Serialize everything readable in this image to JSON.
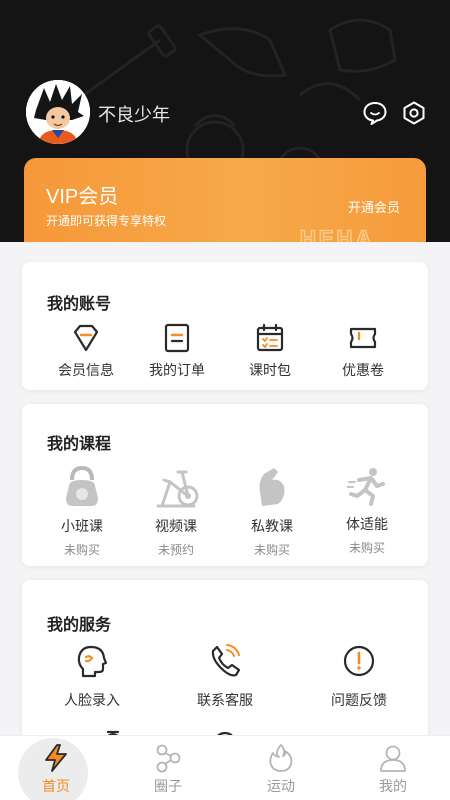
{
  "colors": {
    "accent": "#f58b24",
    "header_bg": "#141414",
    "vip_start": "#f6983a",
    "vip_end": "#f7a948"
  },
  "header": {
    "username": "不良少年",
    "icons": [
      "chat-bubble-icon",
      "settings-hexagon-icon"
    ]
  },
  "vip": {
    "title": "VIP会员",
    "subtitle": "开通即可获得专享特权",
    "open_label": "开通会员",
    "watermark": "HEHA"
  },
  "account": {
    "title": "我的账号",
    "items": [
      {
        "label": "会员信息",
        "icon": "diamond-icon"
      },
      {
        "label": "我的订单",
        "icon": "order-icon"
      },
      {
        "label": "课时包",
        "icon": "calendar-icon"
      },
      {
        "label": "优惠卷",
        "icon": "coupon-icon"
      }
    ]
  },
  "courses": {
    "title": "我的课程",
    "items": [
      {
        "label": "小班课",
        "status": "未购买",
        "icon": "kettlebell-icon"
      },
      {
        "label": "视频课",
        "status": "未预约",
        "icon": "exercise-bike-icon"
      },
      {
        "label": "私教课",
        "status": "未购买",
        "icon": "bicep-icon"
      },
      {
        "label": "体适能",
        "status": "未购买",
        "icon": "runner-icon"
      }
    ]
  },
  "services": {
    "title": "我的服务",
    "items": [
      {
        "label": "人脸录入",
        "icon": "face-icon"
      },
      {
        "label": "联系客服",
        "icon": "phone-icon"
      },
      {
        "label": "问题反馈",
        "icon": "alert-icon"
      }
    ]
  },
  "tabbar": {
    "active": "首页",
    "tabs": [
      {
        "label": "首页",
        "icon": "lightning-icon"
      },
      {
        "label": "圈子",
        "icon": "circles-icon"
      },
      {
        "label": "运动",
        "icon": "flame-icon"
      },
      {
        "label": "我的",
        "icon": "user-icon"
      }
    ]
  }
}
